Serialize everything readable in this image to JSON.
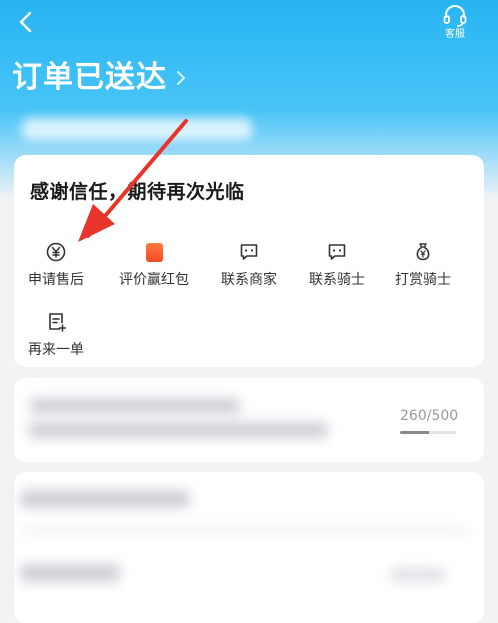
{
  "header": {
    "service_label": "客服",
    "title": "订单已送达"
  },
  "thanks_card": {
    "message": "感谢信任，期待再次光临",
    "actions": [
      {
        "label": "申请售后",
        "icon": "yuan-circle-icon"
      },
      {
        "label": "评价赢红包",
        "icon": "red-packet-icon"
      },
      {
        "label": "联系商家",
        "icon": "chat-bubble-icon"
      },
      {
        "label": "联系骑士",
        "icon": "chat-bubble-icon"
      },
      {
        "label": "打赏骑士",
        "icon": "money-bag-icon"
      },
      {
        "label": "再来一单",
        "icon": "reorder-note-icon"
      }
    ]
  },
  "review_card": {
    "counter": "260/500",
    "progress": 0.52
  },
  "colors": {
    "header_blue": "#27b4f3",
    "arrow_red": "#e8352b",
    "red_packet": "#f24a2a"
  }
}
